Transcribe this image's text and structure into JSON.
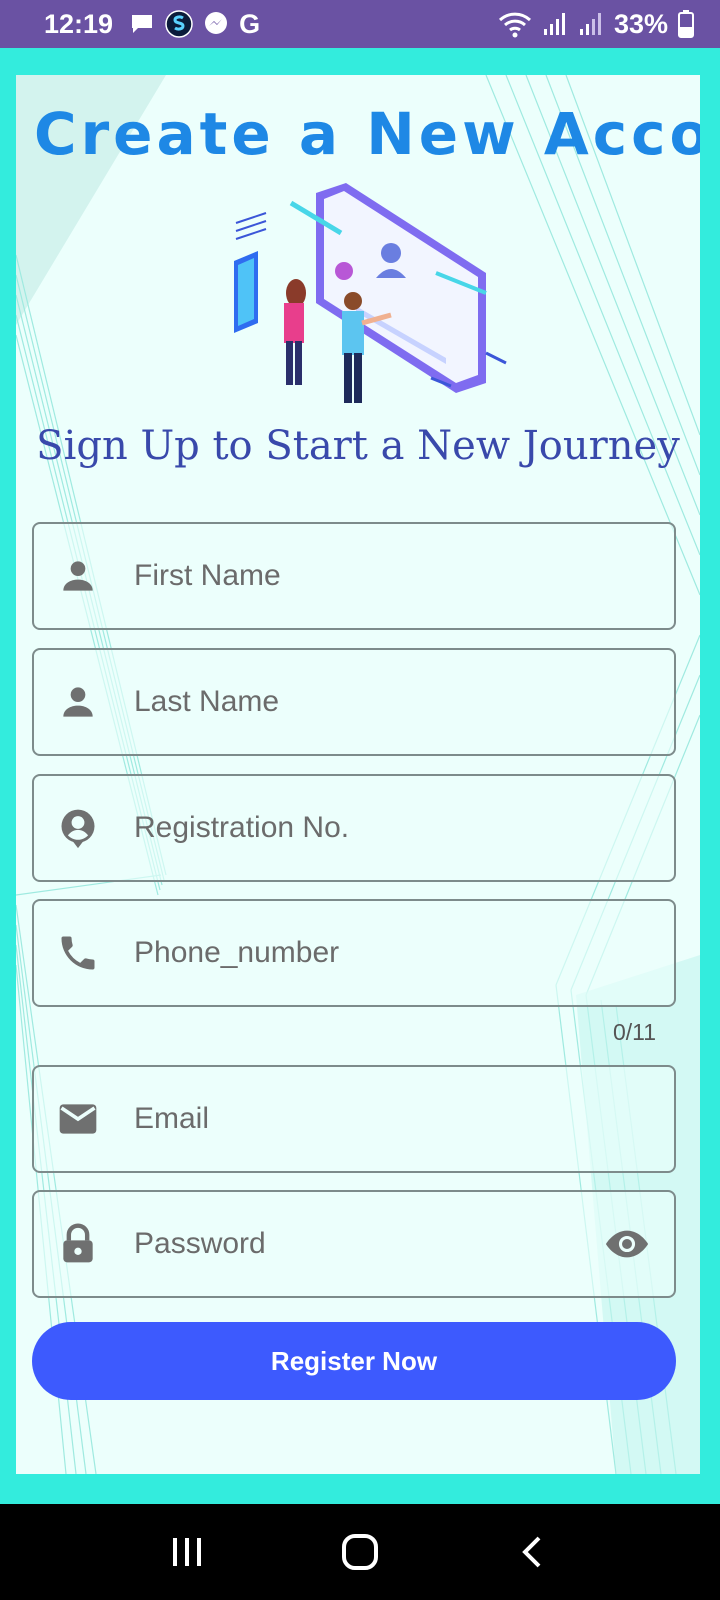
{
  "status_bar": {
    "time": "12:19",
    "battery_text": "33%",
    "google_letter": "G"
  },
  "page": {
    "title": "Create a New Account",
    "subtitle": "Sign Up to Start a New Journey"
  },
  "form": {
    "first_name": {
      "placeholder": "First Name",
      "icon": "person-icon"
    },
    "last_name": {
      "placeholder": "Last Name",
      "icon": "person-icon"
    },
    "registration": {
      "placeholder": "Registration No.",
      "icon": "account-circle-icon"
    },
    "phone": {
      "placeholder": "Phone_number",
      "icon": "phone-icon",
      "counter": "0/11"
    },
    "email": {
      "placeholder": "Email",
      "icon": "mail-icon"
    },
    "password": {
      "placeholder": "Password",
      "icon": "lock-icon",
      "toggle_icon": "eye-icon"
    },
    "submit_label": "Register Now"
  },
  "colors": {
    "status_bar": "#6a52a3",
    "frame": "#33ecdd",
    "card": "#ecfffc",
    "title": "#1e88e5",
    "subtitle": "#3949ab",
    "button": "#3d5afe"
  }
}
